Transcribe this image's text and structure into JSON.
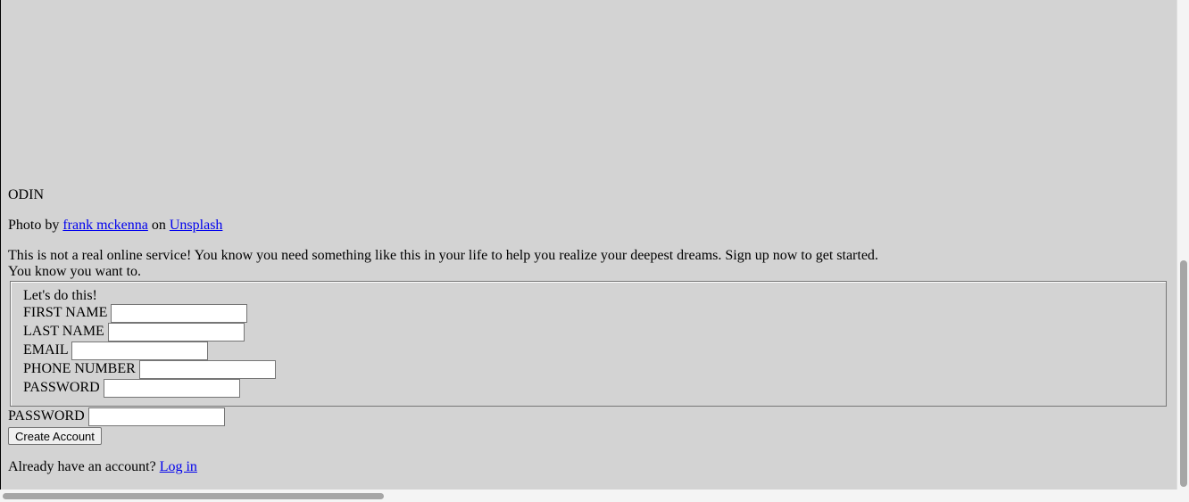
{
  "branding": {
    "logo_text": "ODIN"
  },
  "credit": {
    "prefix": "Photo by",
    "author_link": "frank mckenna",
    "middle": "on",
    "site_link": "Unsplash"
  },
  "intro": {
    "line1": "This is not a real online service! You know you need something like this in your life to help you realize your deepest dreams. Sign up now to get started.",
    "line2": "You know you want to."
  },
  "form": {
    "legend": "Let's do this!",
    "fields": [
      {
        "label": "FIRST NAME",
        "value": ""
      },
      {
        "label": "LAST NAME",
        "value": ""
      },
      {
        "label": "EMAIL",
        "value": ""
      },
      {
        "label": "PHONE NUMBER",
        "value": ""
      },
      {
        "label": "PASSWORD",
        "value": ""
      }
    ],
    "confirm_password_label": "PASSWORD",
    "submit_label": "Create Account"
  },
  "login": {
    "prompt": "Already have an account?",
    "link": "Log in"
  },
  "colors": {
    "page_background": "#d3d3d3",
    "link": "#0000ee"
  }
}
